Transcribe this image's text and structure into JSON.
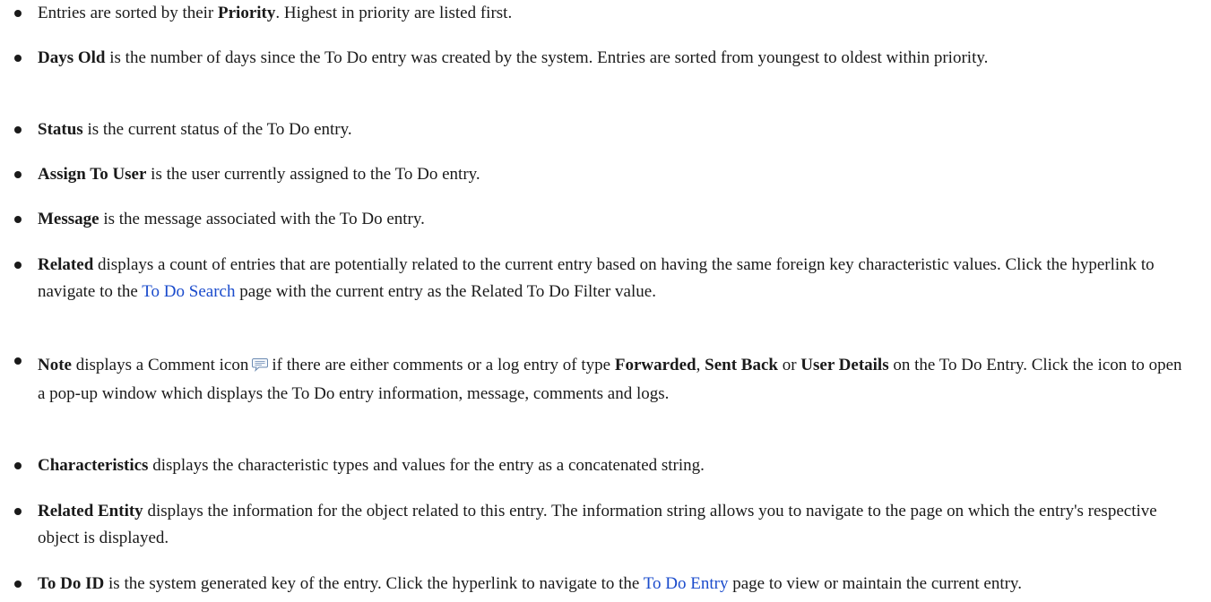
{
  "items": [
    {
      "term": "",
      "pre": "Entries are sorted by their ",
      "bold1": "Priority",
      "post": ". Highest in priority are listed first."
    },
    {
      "term": "Days Old",
      "text": " is the number of days since the To Do entry was created by the system. Entries are sorted from youngest to oldest within priority."
    },
    {
      "term": "Status",
      "text": " is the current status of the To Do entry."
    },
    {
      "term": "Assign To User",
      "text": " is the user currently assigned to the To Do entry."
    },
    {
      "term": "Message",
      "text": " is the message associated with the To Do entry."
    },
    {
      "term": "Related",
      "text": " displays a count of entries that are potentially related to the current entry based on having the same foreign key characteristic values. Click the hyperlink to navigate to the ",
      "link": "To Do Search",
      "text2": " page with the current entry as the Related To Do Filter value."
    },
    {
      "term": "Note",
      "text": " displays a Comment icon",
      "icon": "comment-icon",
      "text2": "if there are either comments or a log entry of type ",
      "bold_a": "Forwarded",
      "sep1": ", ",
      "bold_b": "Sent Back",
      "sep2": " or ",
      "bold_c": "User Details",
      "text3": " on the To Do Entry. Click the icon to open a pop-up window which displays the To Do entry information, message, comments and logs."
    },
    {
      "term": "Characteristics",
      "text": " displays the characteristic types and values for the entry as a concatenated string."
    },
    {
      "term": "Related Entity",
      "text": " displays the information for the object related to this entry. The information string allows you to navigate to the page on which the entry's respective object is displayed."
    },
    {
      "term": "To Do ID",
      "text": " is the system generated key of the entry. Click the hyperlink to navigate to the ",
      "link": "To Do Entry",
      "text2": " page to view or maintain the current entry."
    }
  ],
  "colors": {
    "text": "#1a1a1a",
    "link": "#1a4bcc"
  }
}
